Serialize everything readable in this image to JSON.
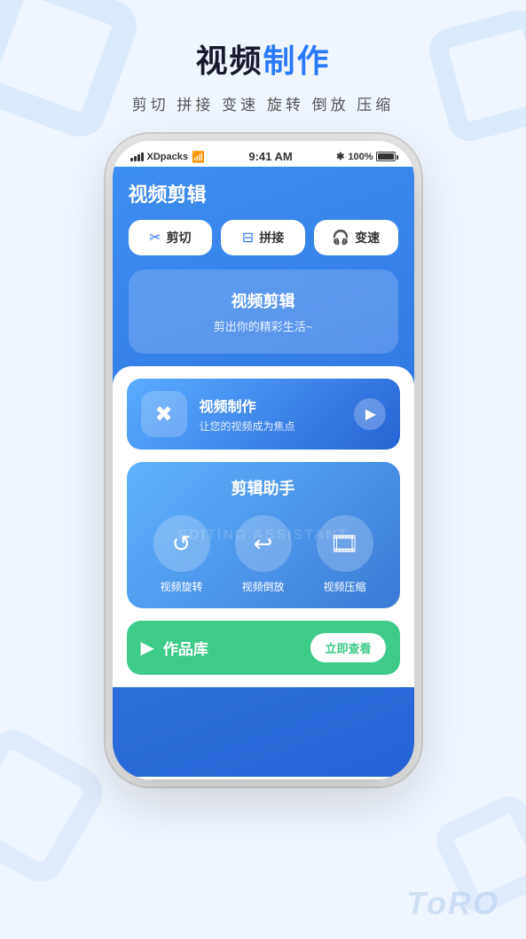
{
  "background": {
    "color": "#f0f6ff"
  },
  "top_section": {
    "title_part1": "视频",
    "title_part2": "制作",
    "subtitle": "剪切 拼接 变速 旋转 倒放 压缩"
  },
  "status_bar": {
    "carrier": "XDpacks",
    "time": "9:41 AM",
    "bluetooth": "✱",
    "battery": "100%"
  },
  "app": {
    "title": "视频剪辑",
    "feature_buttons": [
      {
        "icon": "✂",
        "label": "剪切"
      },
      {
        "icon": "⊟",
        "label": "拼接"
      },
      {
        "icon": "🎧",
        "label": "变速"
      }
    ],
    "hero_card": {
      "title": "视频剪辑",
      "subtitle": "剪出你的精彩生活~"
    },
    "production_card": {
      "title": "视频制作",
      "desc": "让您的视频成为焦点",
      "play_icon": "▶"
    },
    "editing_section": {
      "title": "剪辑助手",
      "bg_text": "EDITING ASSISTANT",
      "tools": [
        {
          "label": "视频旋转",
          "icon": "↺"
        },
        {
          "label": "视频倒放",
          "icon": "↩"
        },
        {
          "label": "视频压缩",
          "icon": "🎞"
        }
      ]
    },
    "works_bar": {
      "icon": "▶",
      "title": "作品库",
      "button": "立即查看"
    }
  },
  "branding": {
    "toro": "ToRO"
  }
}
